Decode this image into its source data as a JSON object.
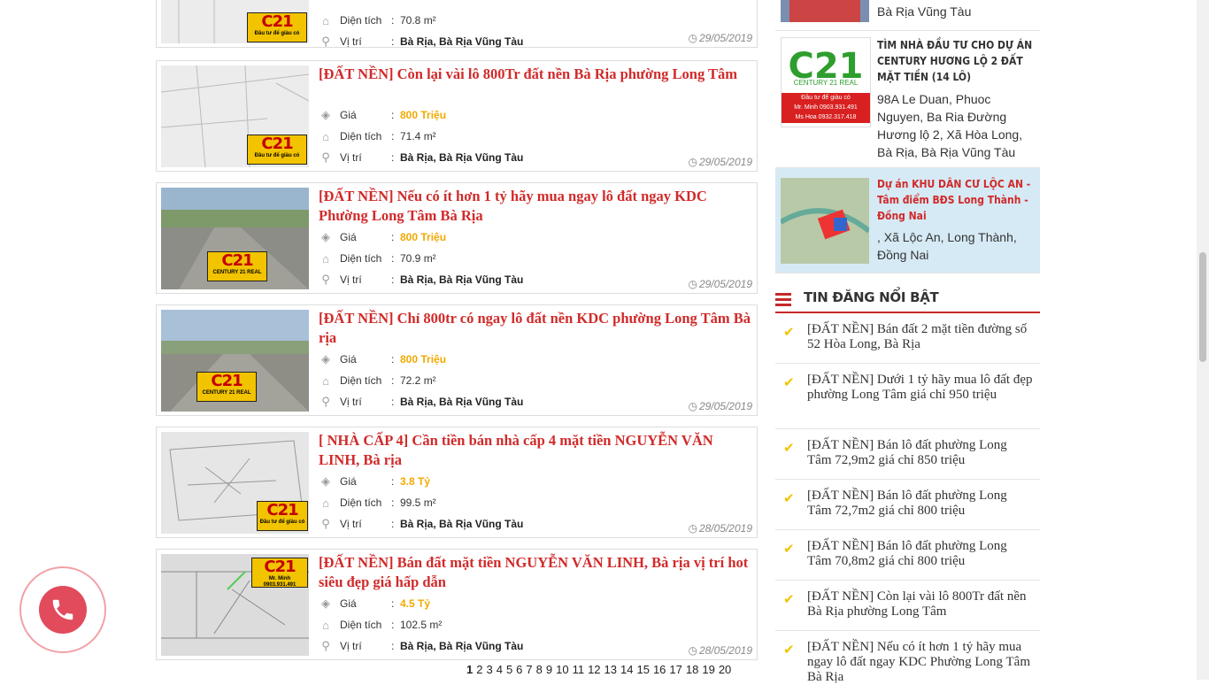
{
  "listings": [
    {
      "title": "",
      "price": "",
      "area": "70.8 m²",
      "location": "Bà Rịa, Bà Rịa Vũng Tàu",
      "date": "29/05/2019",
      "thumb": "plan"
    },
    {
      "title": "[ĐẤT NỀN] Còn lại vài lô 800Tr đất nền Bà Rịa phường Long Tâm",
      "price": "800 Triệu",
      "area": "71.4 m²",
      "location": "Bà Rịa, Bà Rịa Vũng Tàu",
      "date": "29/05/2019",
      "thumb": "plan"
    },
    {
      "title": "[ĐẤT NỀN] Nếu có ít hơn 1 tỷ hãy mua ngay lô đất ngay KDC Phường Long Tâm Bà Rịa",
      "price": "800 Triệu",
      "area": "70.9 m²",
      "location": "Bà Rịa, Bà Rịa Vũng Tàu",
      "date": "29/05/2019",
      "thumb": "road"
    },
    {
      "title": "[ĐẤT NỀN] Chỉ 800tr có ngay lô đất nền KDC phường Long Tâm Bà rịa",
      "price": "800 Triệu",
      "area": "72.2 m²",
      "location": "Bà Rịa, Bà Rịa Vũng Tàu",
      "date": "29/05/2019",
      "thumb": "road"
    },
    {
      "title": "[ NHÀ CẤP 4] Cần tiền bán nhà cấp 4 mặt tiền NGUYỄN VĂN LINH, Bà rịa",
      "price": "3.8 Tỷ",
      "area": "99.5 m²",
      "location": "Bà Rịa, Bà Rịa Vũng Tàu",
      "date": "28/05/2019",
      "thumb": "sketch"
    },
    {
      "title": "[ĐẤT NỀN] Bán đất mặt tiền NGUYỄN VĂN LINH, Bà rịa vị trí hot siêu đẹp giá hấp dẫn",
      "price": "4.5 Tỷ",
      "area": "102.5 m²",
      "location": "Bà Rịa, Bà Rịa Vũng Tàu",
      "date": "28/05/2019",
      "thumb": "sketch"
    }
  ],
  "labels": {
    "price": "Giá",
    "area": "Diện tích",
    "location": "Vị trí",
    "colon": ":"
  },
  "logo": {
    "mark": "C21",
    "brand": "CENTURY 21 REAL",
    "slogan": "Đầu tư để giàu có",
    "contact1": "Mr. Minh 0903.931.491",
    "contact2": "Ms Hoa 0932.317.418"
  },
  "pagination": [
    "1",
    "2",
    "3",
    "4",
    "5",
    "6",
    "7",
    "8",
    "9",
    "10",
    "11",
    "12",
    "13",
    "14",
    "15",
    "16",
    "17",
    "18",
    "19",
    "20"
  ],
  "sidebar": {
    "projects": [
      {
        "title": "",
        "address": "Bà Rịa Vũng Tàu"
      },
      {
        "title": "TÌM NHÀ ĐẦU TƯ CHO DỰ ÁN CENTURY HƯƠNG LỘ 2 ĐẤT MẶT TIỀN (14 LÔ)",
        "address": "98A Le Duan, Phuoc Nguyen, Ba Ria Đường Hương lộ 2, Xã Hòa Long, Bà Rịa, Bà Rịa Vũng Tàu"
      },
      {
        "title": "Dự án KHU DÂN CƯ LỘC AN - Tâm điểm BĐS Long Thành - Đồng Nai",
        "address": ", Xã Lộc An, Long Thành, Đồng Nai"
      }
    ],
    "hot_title": "TIN ĐĂNG NỔI BẬT",
    "hot_items": [
      "[ĐẤT NỀN] Bán đất 2 mặt tiền đường số 52 Hòa Long, Bà Rịa",
      "[ĐẤT NỀN] Dưới 1 tỷ hãy mua lô đất đẹp phường Long Tâm giá chỉ 950 triệu",
      "[ĐẤT NỀN] Bán lô đất phường Long Tâm 72,9m2 giá chỉ 850 triệu",
      "[ĐẤT NỀN] Bán lô đất phường Long Tâm 72,7m2 giá chỉ 800 triệu",
      "[ĐẤT NỀN] Bán lô đất phường Long Tâm 70,8m2 giá chỉ 800 triệu",
      "[ĐẤT NỀN] Còn lại vài lô 800Tr đất nền Bà Rịa phường Long Tâm",
      "[ĐẤT NỀN] Nếu có ít hơn 1 tỷ hãy mua ngay lô đất ngay KDC Phường Long Tâm Bà Rịa"
    ]
  },
  "colors": {
    "title_red": "#d12a2a",
    "price_gold": "#f2a900",
    "logo_yellow": "#f2c400",
    "call_red": "#e14b5b"
  }
}
